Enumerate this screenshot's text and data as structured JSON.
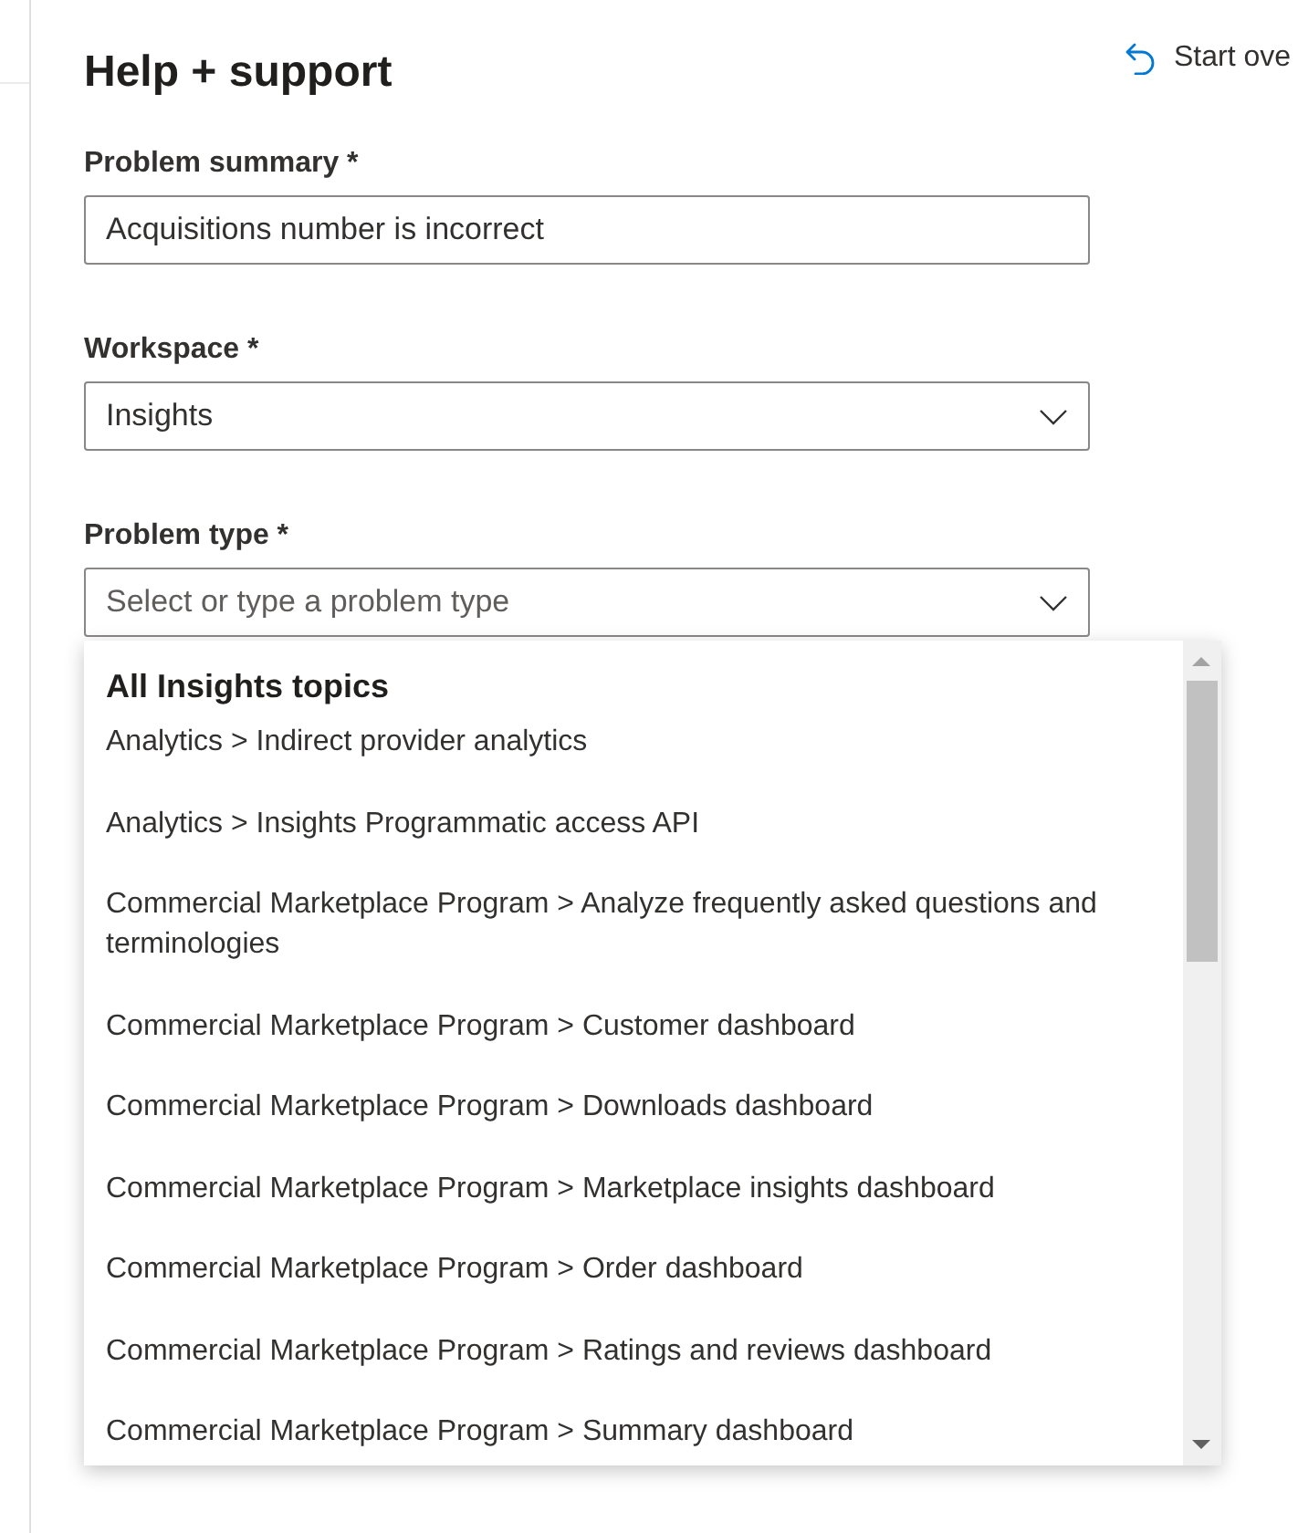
{
  "header": {
    "title": "Help + support",
    "start_over": "Start ove"
  },
  "fields": [
    {
      "kind": "text",
      "label": "Problem summary *",
      "value": "Acquisitions number is incorrect"
    },
    {
      "kind": "select",
      "label": "Workspace *",
      "value": "Insights"
    },
    {
      "kind": "combo",
      "label": "Problem type *",
      "placeholder": "Select or type a problem type",
      "expanded": true,
      "dropdown": {
        "heading": "All Insights topics",
        "options": [
          "Analytics > Indirect provider analytics",
          "Analytics > Insights Programmatic access API",
          "Commercial Marketplace Program > Analyze frequently asked questions and terminologies",
          "Commercial Marketplace Program > Customer dashboard",
          "Commercial Marketplace Program > Downloads dashboard",
          "Commercial Marketplace Program > Marketplace insights dashboard",
          "Commercial Marketplace Program > Order dashboard",
          "Commercial Marketplace Program > Ratings and reviews dashboard",
          "Commercial Marketplace Program > Summary dashboard"
        ]
      }
    }
  ]
}
